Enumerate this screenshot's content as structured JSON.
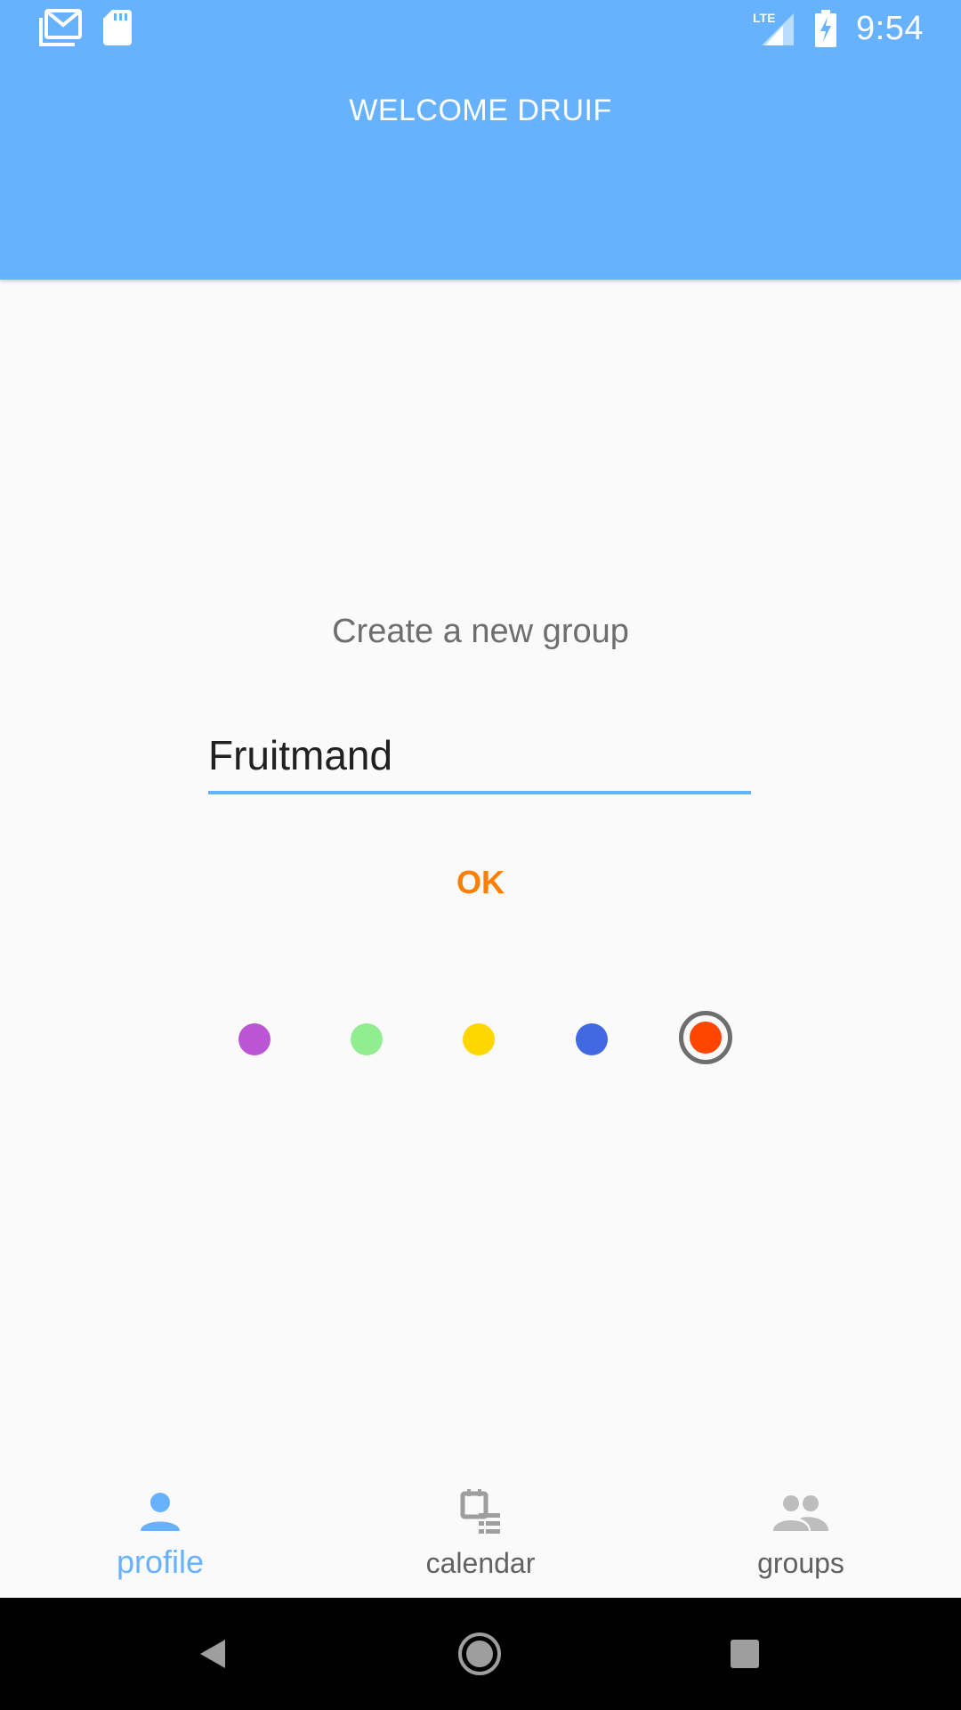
{
  "status_bar": {
    "time": "9:54",
    "network": "LTE",
    "icons": [
      "gmail-icon",
      "sd-card-icon",
      "lte-signal-icon",
      "battery-charging-icon"
    ]
  },
  "header": {
    "title": "WELCOME DRUIF",
    "background_color": "#66B2FF"
  },
  "dialog": {
    "title": "Create a new group",
    "group_name_value": "Fruitmand",
    "ok_label": "OK",
    "ok_color": "#FF7F00",
    "colors": [
      {
        "name": "purple",
        "hex": "#BA55D3",
        "selected": false
      },
      {
        "name": "green",
        "hex": "#90EE90",
        "selected": false
      },
      {
        "name": "yellow",
        "hex": "#FFD700",
        "selected": false
      },
      {
        "name": "blue",
        "hex": "#4169E1",
        "selected": false
      },
      {
        "name": "orange-red",
        "hex": "#FF4500",
        "selected": true
      }
    ]
  },
  "bottom_nav": {
    "active": "profile",
    "active_color": "#66B2FF",
    "items": [
      {
        "key": "profile",
        "label": "profile",
        "icon": "person-icon"
      },
      {
        "key": "calendar",
        "label": "calendar",
        "icon": "calendar-icon"
      },
      {
        "key": "groups",
        "label": "groups",
        "icon": "group-icon"
      }
    ]
  },
  "system_nav": {
    "buttons": [
      "back-icon",
      "home-icon",
      "recents-icon"
    ]
  }
}
